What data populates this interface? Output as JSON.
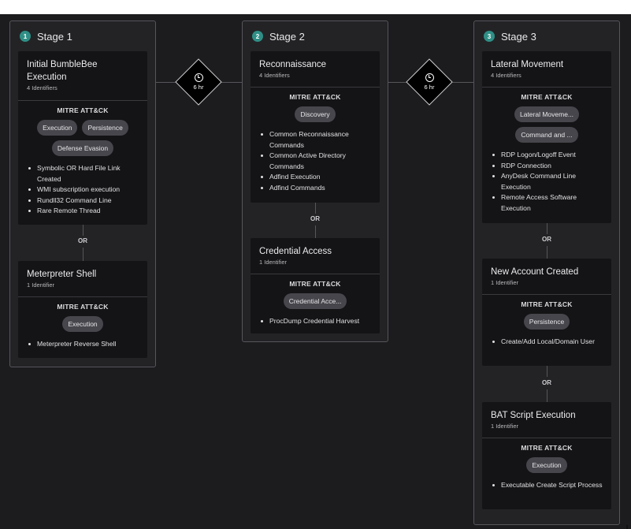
{
  "stages": [
    {
      "num": "1",
      "label": "Stage 1",
      "cards": [
        {
          "title": "Initial BumbleBee Execution",
          "sub": "4 Identifiers",
          "mitre": "MITRE ATT&CK",
          "tags": [
            "Execution",
            "Persistence",
            "Defense Evasion"
          ],
          "items": [
            "Symbolic OR Hard File Link Created",
            "WMI subscription execution",
            "Rundll32 Command Line",
            "Rare Remote Thread"
          ]
        },
        {
          "title": "Meterpreter Shell",
          "sub": "1 Identifier",
          "mitre": "MITRE ATT&CK",
          "tags": [
            "Execution"
          ],
          "items": [
            "Meterpreter Reverse Shell"
          ]
        }
      ]
    },
    {
      "num": "2",
      "label": "Stage 2",
      "cards": [
        {
          "title": "Reconnaissance",
          "sub": "4 Identifiers",
          "mitre": "MITRE ATT&CK",
          "tags": [
            "Discovery"
          ],
          "items": [
            "Common Reconnaissance Commands",
            "Common Active Directory Commands",
            "Adfind Execution",
            "Adfind Commands"
          ]
        },
        {
          "title": "Credential Access",
          "sub": "1 Identifier",
          "mitre": "MITRE ATT&CK",
          "tags": [
            "Credential Acce..."
          ],
          "items": [
            "ProcDump Credential Harvest"
          ]
        }
      ]
    },
    {
      "num": "3",
      "label": "Stage 3",
      "cards": [
        {
          "title": "Lateral Movement",
          "sub": "4 Identifiers",
          "mitre": "MITRE ATT&CK",
          "tags": [
            "Lateral Moveme...",
            "Command and ..."
          ],
          "items": [
            "RDP Logon/Logoff Event",
            "RDP Connection",
            "AnyDesk Command Line Execution",
            "Remote Access Software Execution"
          ]
        },
        {
          "title": "New Account Created",
          "sub": "1 Identifier",
          "mitre": "MITRE ATT&CK",
          "tags": [
            "Persistence"
          ],
          "items": [
            "Create/Add Local/Domain User"
          ]
        },
        {
          "title": "BAT Script Execution",
          "sub": "1 Identifier",
          "mitre": "MITRE ATT&CK",
          "tags": [
            "Execution"
          ],
          "items": [
            "Executable Create Script Process"
          ]
        }
      ]
    }
  ],
  "or_label": "OR",
  "connectors": [
    {
      "icon": "clock-icon",
      "label": "6 hr"
    },
    {
      "icon": "clock-icon",
      "label": "6 hr"
    }
  ],
  "colors": {
    "background": "#1c1c1f",
    "panel": "#232326",
    "card": "#141416",
    "tag": "#46464c",
    "stage_badge": "#2f8f86"
  }
}
